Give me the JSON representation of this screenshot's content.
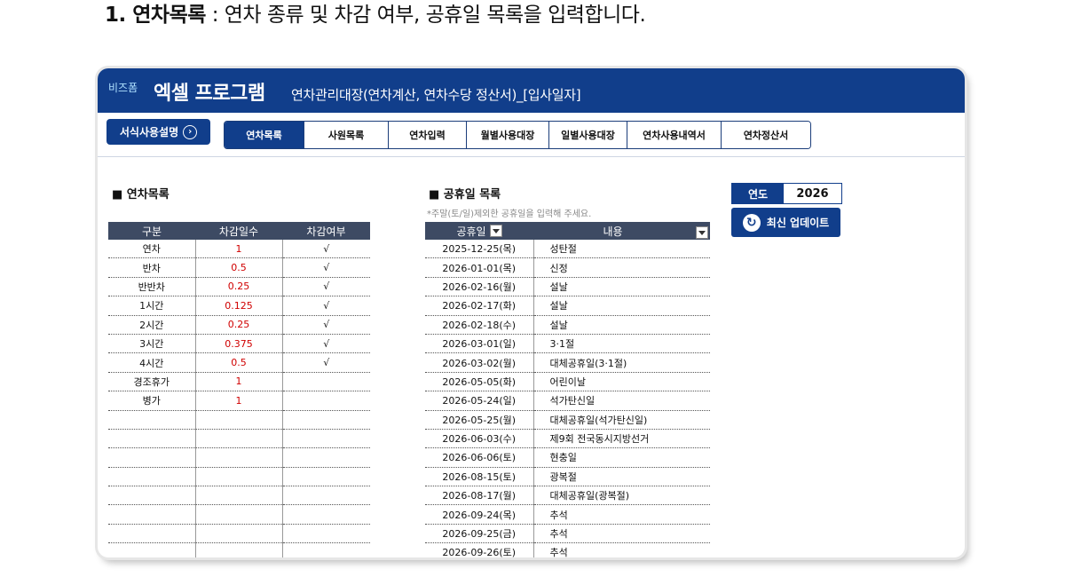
{
  "headline": {
    "bold": "1. 연차목록",
    "rest": " : 연차 종류 및 차감 여부, 공휴일 목록을 입력합니다."
  },
  "app": {
    "brand_small": "비즈폼",
    "brand_big": "엑셀 프로그램",
    "title": "연차관리대장(연차계산, 연차수당 정산서)_[입사일자]"
  },
  "toolbar": {
    "guide_label": "서식사용설명",
    "tabs": [
      "연차목록",
      "사원목록",
      "연차입력",
      "월별사용대장",
      "일별사용대장",
      "연차사용내역서",
      "연차정산서"
    ]
  },
  "leave_list": {
    "title": "■ 연차목록",
    "headers": [
      "구분",
      "차감일수",
      "차감여부"
    ],
    "rows": [
      [
        "연차",
        "1",
        "√"
      ],
      [
        "반차",
        "0.5",
        "√"
      ],
      [
        "반반차",
        "0.25",
        "√"
      ],
      [
        "1시간",
        "0.125",
        "√"
      ],
      [
        "2시간",
        "0.25",
        "√"
      ],
      [
        "3시간",
        "0.375",
        "√"
      ],
      [
        "4시간",
        "0.5",
        "√"
      ],
      [
        "경조휴가",
        "1",
        ""
      ],
      [
        "병가",
        "1",
        ""
      ],
      [
        "",
        "",
        ""
      ],
      [
        "",
        "",
        ""
      ],
      [
        "",
        "",
        ""
      ],
      [
        "",
        "",
        ""
      ],
      [
        "",
        "",
        ""
      ],
      [
        "",
        "",
        ""
      ],
      [
        "",
        "",
        ""
      ],
      [
        "",
        "",
        ""
      ]
    ]
  },
  "holidays": {
    "title": "■ 공휴일 목록",
    "hint": "*주말(토/일)제외한 공휴일을 입력해 주세요.",
    "headers": [
      "공휴일",
      "내용"
    ],
    "rows": [
      [
        "2025-12-25(목)",
        "성탄절"
      ],
      [
        "2026-01-01(목)",
        "신정"
      ],
      [
        "2026-02-16(월)",
        "설날"
      ],
      [
        "2026-02-17(화)",
        "설날"
      ],
      [
        "2026-02-18(수)",
        "설날"
      ],
      [
        "2026-03-01(일)",
        "3·1절"
      ],
      [
        "2026-03-02(월)",
        "대체공휴일(3·1절)"
      ],
      [
        "2026-05-05(화)",
        "어린이날"
      ],
      [
        "2026-05-24(일)",
        "석가탄신일"
      ],
      [
        "2026-05-25(월)",
        "대체공휴일(석가탄신일)"
      ],
      [
        "2026-06-03(수)",
        "제9회 전국동시지방선거"
      ],
      [
        "2026-06-06(토)",
        "현충일"
      ],
      [
        "2026-08-15(토)",
        "광복절"
      ],
      [
        "2026-08-17(월)",
        "대체공휴일(광복절)"
      ],
      [
        "2026-09-24(목)",
        "추석"
      ],
      [
        "2026-09-25(금)",
        "추석"
      ],
      [
        "2026-09-26(토)",
        "추석"
      ]
    ]
  },
  "year": {
    "label": "연도",
    "value": "2026"
  },
  "update_button": {
    "label": "최신 업데이트"
  }
}
